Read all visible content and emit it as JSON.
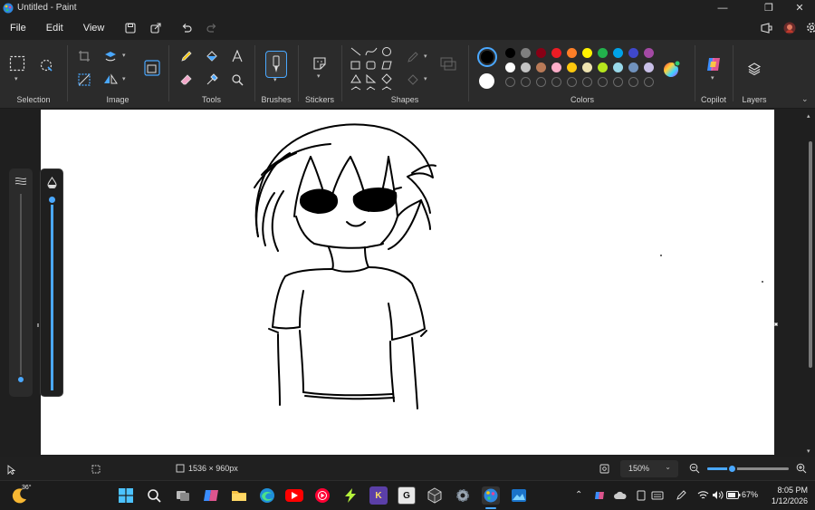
{
  "window": {
    "title": "Untitled - Paint"
  },
  "menu": {
    "file": "File",
    "edit": "Edit",
    "view": "View"
  },
  "ribbon": {
    "groups": {
      "selection": "Selection",
      "image": "Image",
      "tools": "Tools",
      "brushes": "Brushes",
      "stickers": "Stickers",
      "shapes": "Shapes",
      "colors": "Colors",
      "copilot": "Copilot",
      "layers": "Layers"
    },
    "colors": {
      "primary": "#000000",
      "secondary": "#ffffff",
      "row1": [
        "#000000",
        "#7f7f7f",
        "#880015",
        "#ed1c24",
        "#ff7f27",
        "#fff200",
        "#22b14c",
        "#00a2e8",
        "#3f48cc",
        "#a349a4"
      ],
      "row2": [
        "#ffffff",
        "#c3c3c3",
        "#b97a57",
        "#ffaec9",
        "#ffc90e",
        "#efe4b0",
        "#b5e61d",
        "#99d9ea",
        "#7092be",
        "#c8bfe7"
      ]
    }
  },
  "status": {
    "canvas_size": "1536 × 960px",
    "zoom": "150%",
    "zoom_level": 0.3
  },
  "taskbar": {
    "weather_temp": "36°",
    "battery": "67%",
    "time": "8:05 PM",
    "date": "1/12/2026"
  }
}
